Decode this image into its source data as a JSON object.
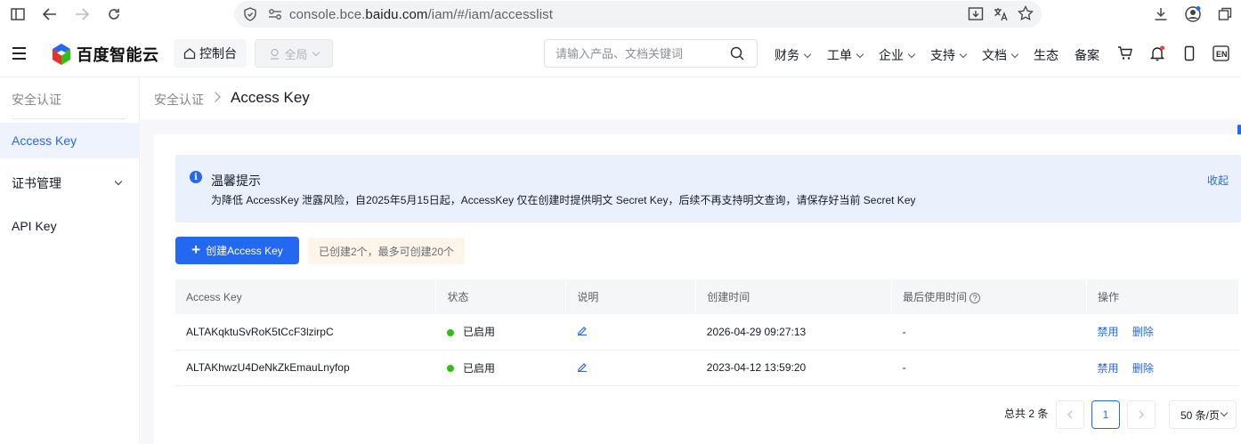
{
  "browser": {
    "url_prefix": "console.bce.",
    "url_domain": "baidu.com",
    "url_path": "/iam/#/iam/accesslist"
  },
  "topnav": {
    "brand": "百度智能云",
    "console_label": "控制台",
    "region_label": "全局",
    "search_placeholder": "请输入产品、文档关键词",
    "items": [
      "财务",
      "工单",
      "企业",
      "支持",
      "文档",
      "生态",
      "备案"
    ],
    "lang": "EN"
  },
  "sidebar": {
    "header": "安全认证",
    "items": [
      {
        "label": "Access Key",
        "active": true
      },
      {
        "label": "证书管理",
        "expandable": true
      },
      {
        "label": "API Key"
      }
    ]
  },
  "breadcrumb": {
    "parent": "安全认证",
    "current": "Access Key"
  },
  "notice": {
    "title": "温馨提示",
    "body": "为降低 AccessKey 泄露风险，自2025年5月15日起，AccessKey 仅在创建时提供明文 Secret Key，后续不再支持明文查询，请保存好当前 Secret Key",
    "collapse": "收起"
  },
  "actions": {
    "create_label": "创建Access Key",
    "quota_text": "已创建2个，最多可创建20个"
  },
  "table": {
    "columns": [
      "Access Key",
      "状态",
      "说明",
      "创建时间",
      "最后使用时间",
      "操作"
    ],
    "rows": [
      {
        "key": "ALTAKqktuSvRoK5tCcF3lzirpC",
        "status": "已启用",
        "created": "2026-04-29 09:27:13",
        "last_used": "-",
        "op_disable": "禁用",
        "op_delete": "删除"
      },
      {
        "key": "ALTAKhwzU4DeNkZkEmauLnyfop",
        "status": "已启用",
        "created": "2023-04-12 13:59:20",
        "last_used": "-",
        "op_disable": "禁用",
        "op_delete": "删除"
      }
    ]
  },
  "pagination": {
    "total_text": "总共 2 条",
    "current_page": "1",
    "page_size": "50 条/页"
  },
  "colors": {
    "accent": "#2468f2",
    "status_enabled": "#30bf13",
    "notice_bg": "#eaf1fd"
  }
}
